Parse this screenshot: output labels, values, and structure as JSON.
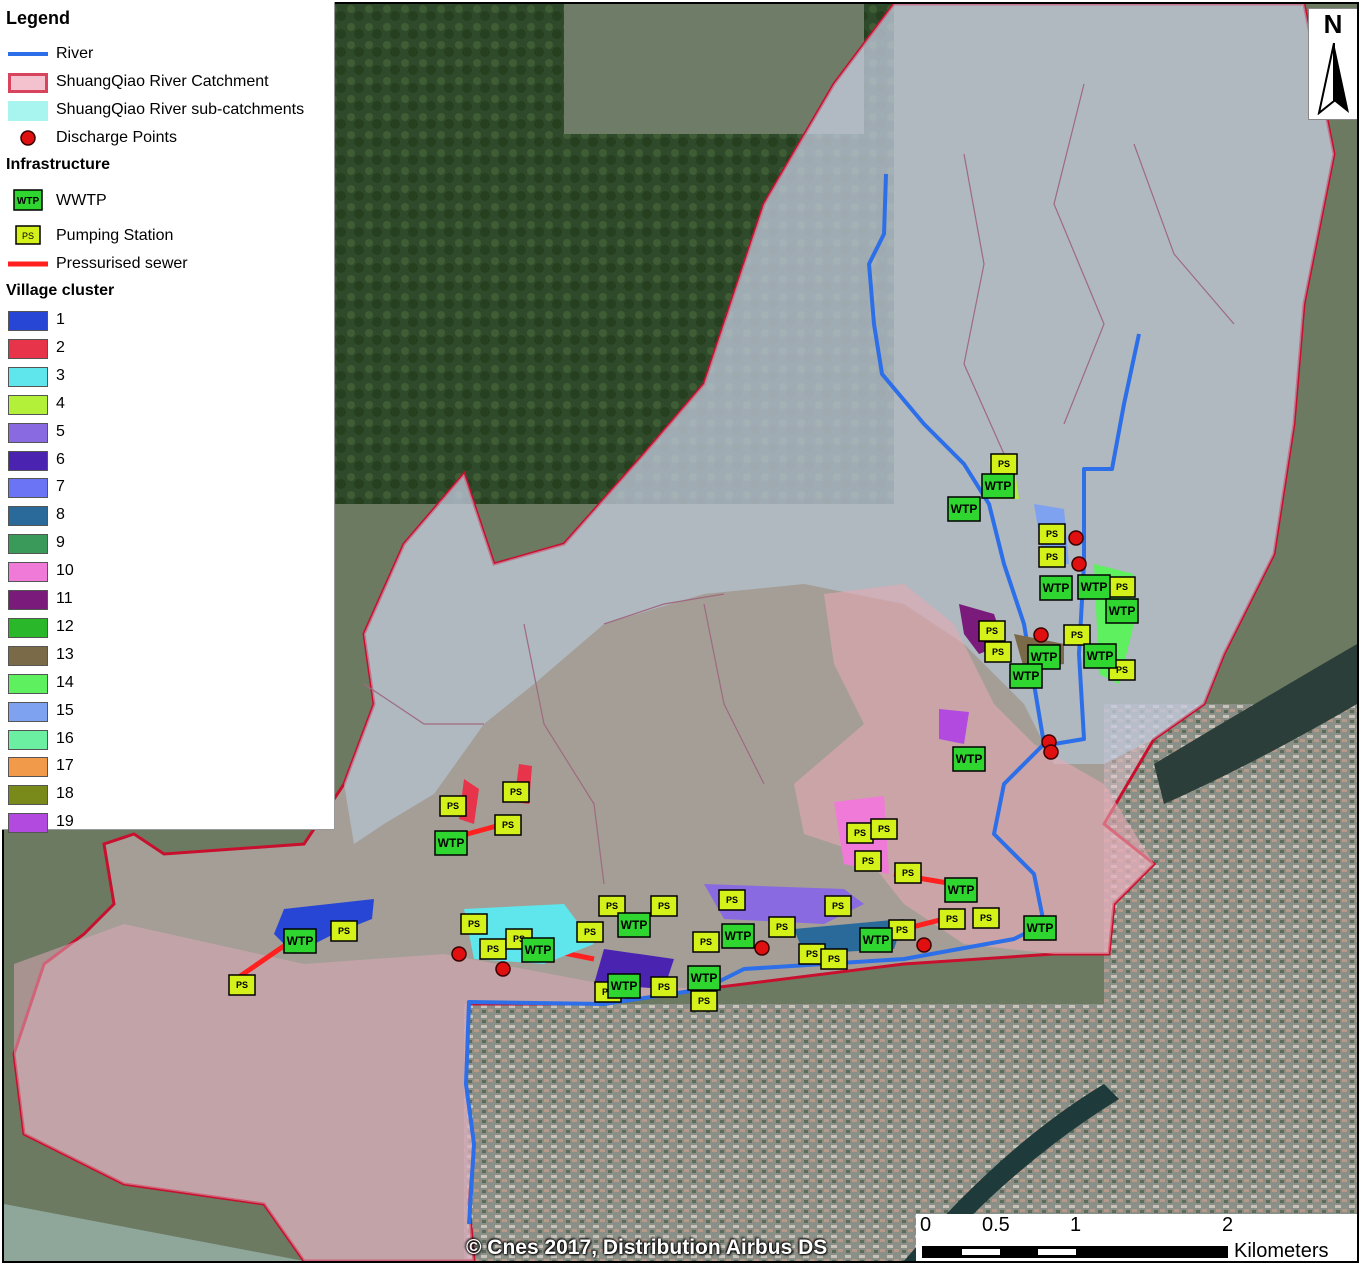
{
  "legend": {
    "title": "Legend",
    "items": [
      {
        "label": "River",
        "symbol": "blue-line",
        "color": "#2d6fe8"
      },
      {
        "label": "ShuangQiao River Catchment",
        "symbol": "pink-fill",
        "color": "#f4c2cf"
      },
      {
        "label": "ShuangQiao River sub-catchments",
        "symbol": "cyan-fill",
        "color": "#a8f5f0"
      },
      {
        "label": "Discharge Points",
        "symbol": "red-circle",
        "color": "#e01010"
      }
    ],
    "infrastructure_heading": "Infrastructure",
    "infrastructure": [
      {
        "label": "WWTP",
        "symbol_text": "WTP"
      },
      {
        "label": "Pumping Station",
        "symbol_text": "PS"
      },
      {
        "label": "Pressurised sewer",
        "color": "#ff2020"
      }
    ],
    "cluster_heading": "Village cluster",
    "clusters": [
      {
        "label": "1",
        "color": "#2746d6"
      },
      {
        "label": "2",
        "color": "#e8344a"
      },
      {
        "label": "3",
        "color": "#5ee6ec"
      },
      {
        "label": "4",
        "color": "#b2f03a"
      },
      {
        "label": "5",
        "color": "#8a6ae0"
      },
      {
        "label": "6",
        "color": "#4a24b0"
      },
      {
        "label": "7",
        "color": "#6a74f4"
      },
      {
        "label": "8",
        "color": "#2a6a9a"
      },
      {
        "label": "9",
        "color": "#3a9a5a"
      },
      {
        "label": "10",
        "color": "#f07ad8"
      },
      {
        "label": "11",
        "color": "#7a1a7a"
      },
      {
        "label": "12",
        "color": "#2ab82a"
      },
      {
        "label": "13",
        "color": "#7a6a48"
      },
      {
        "label": "14",
        "color": "#5ef05e"
      },
      {
        "label": "15",
        "color": "#7ea2f0"
      },
      {
        "label": "16",
        "color": "#6af0a0"
      },
      {
        "label": "17",
        "color": "#f09a4a"
      },
      {
        "label": "18",
        "color": "#7a8a1a"
      },
      {
        "label": "19",
        "color": "#b24ae0"
      }
    ]
  },
  "north_arrow": {
    "letter": "N"
  },
  "scale_bar": {
    "labels": [
      "0",
      "0.5",
      "1",
      "2"
    ],
    "unit": "Kilometers"
  },
  "copyright": "© Cnes 2017, Distribution Airbus DS",
  "map_labels": {
    "wwtp": "WTP",
    "pumping_station": "PS"
  }
}
